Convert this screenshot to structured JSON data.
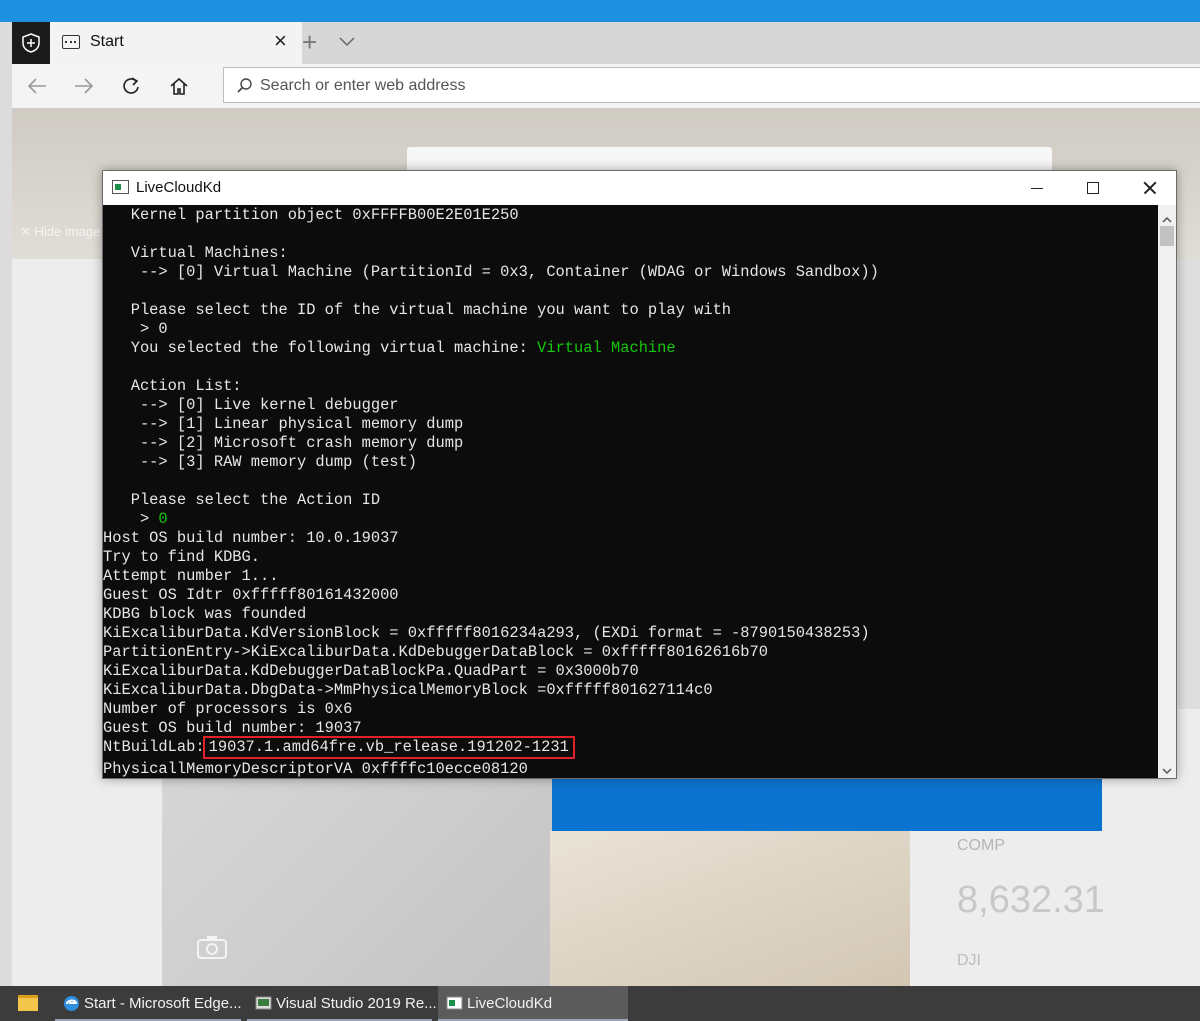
{
  "browser": {
    "tab_title": "Start",
    "address_placeholder": "Search or enter web address",
    "page": {
      "hide_image": "✕  Hide image",
      "stocks_label": "COMP",
      "stocks_value": "8,632.31",
      "stocks_label2": "DJI"
    }
  },
  "window": {
    "title": "LiveCloudKd"
  },
  "console": {
    "lines": [
      "   Kernel partition object 0xFFFFB00E2E01E250",
      "",
      "   Virtual Machines:",
      "    --> [0] Virtual Machine (PartitionId = 0x3, Container (WDAG or Windows Sandbox))",
      "",
      "   Please select the ID of the virtual machine you want to play with",
      "    > 0",
      "   You selected the following virtual machine: ",
      "",
      "   Action List:",
      "    --> [0] Live kernel debugger",
      "    --> [1] Linear physical memory dump",
      "    --> [2] Microsoft crash memory dump",
      "    --> [3] RAW memory dump (test)",
      "",
      "   Please select the Action ID",
      "    > ",
      "Host OS build number: 10.0.19037",
      "Try to find KDBG.",
      "Attempt number 1...",
      "Guest OS Idtr 0xfffff80161432000",
      "KDBG block was founded",
      "KiExcaliburData.KdVersionBlock = 0xfffff8016234a293, (EXDi format = -8790150438253)",
      "PartitionEntry->KiExcaliburData.KdDebuggerDataBlock = 0xfffff80162616b70",
      "KiExcaliburData.KdDebuggerDataBlockPa.QuadPart = 0x3000b70",
      "KiExcaliburData.DbgData->MmPhysicalMemoryBlock =0xfffff801627114c0",
      "Number of processors is 0x6",
      "Guest OS build number: 19037",
      "NtBuildLab:",
      "PhysicallMemoryDescriptorVA 0xffffc10ecce08120"
    ],
    "selected_vm": "Virtual Machine",
    "selected_action": "0",
    "ntbuildlab_value": "19037.1.amd64fre.vb_release.191202-1231",
    "colors": {
      "text": "#e6e6e6",
      "green": "#16c60c",
      "highlight_border": "#e0232b",
      "background": "#0c0c0c"
    }
  },
  "taskbar": {
    "items": [
      {
        "label": "Start - Microsoft Edge...",
        "icon": "edge-icon"
      },
      {
        "label": "Visual Studio 2019 Re...",
        "icon": "visual-studio-icon"
      },
      {
        "label": "LiveCloudKd",
        "icon": "console-icon"
      }
    ]
  }
}
